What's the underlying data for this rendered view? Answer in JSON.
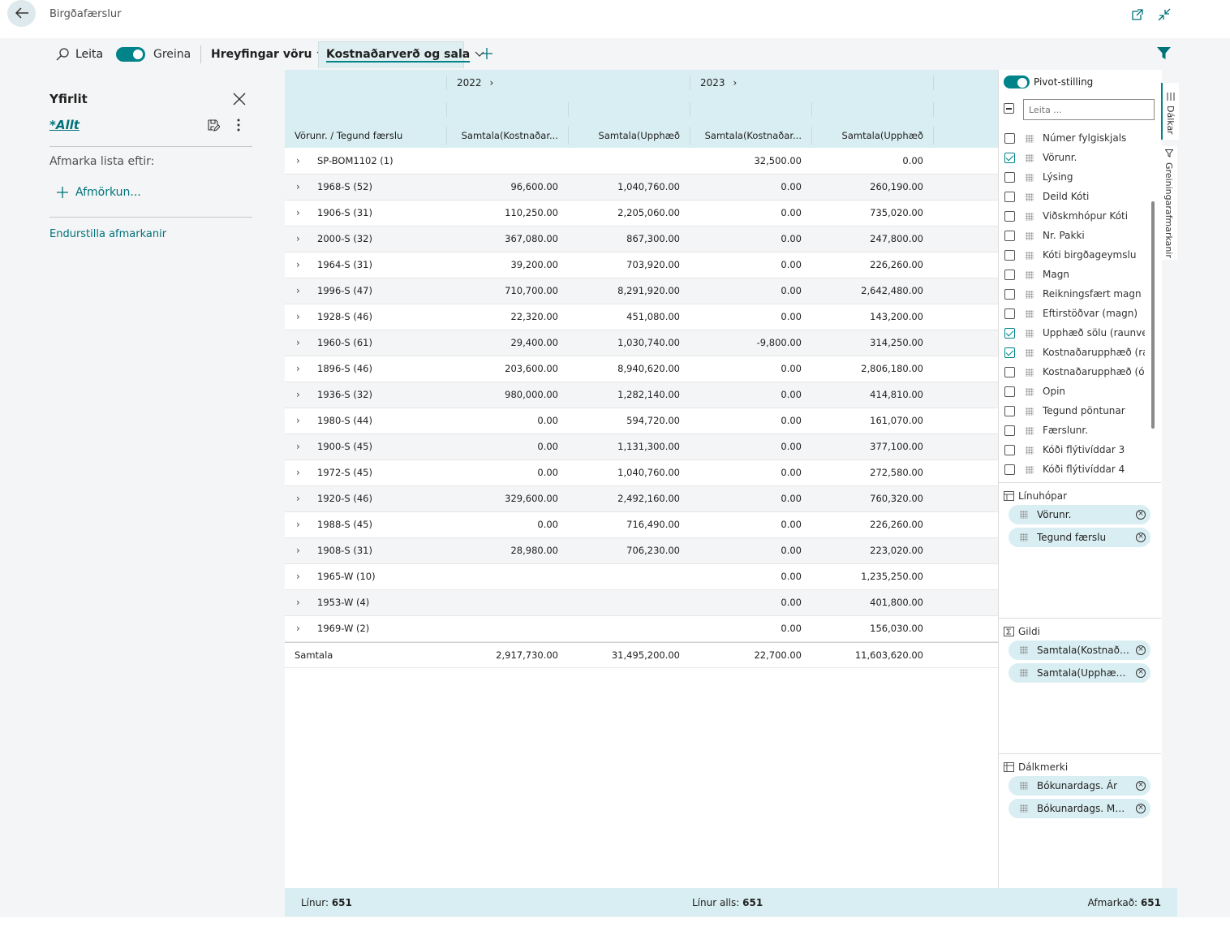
{
  "header": {
    "title": "Birgðafærslur"
  },
  "toolbar": {
    "search_label": "Leita",
    "analyze_label": "Greina",
    "tab1_label": "Hreyfingar vöru",
    "tab2_label": "Kostnaðarverð og sala"
  },
  "left_pane": {
    "title": "Yfirlit",
    "view_name": "*Allt",
    "filter_heading": "Afmarka lista eftir:",
    "add_filter_label": "Afmörkun...",
    "reset_label": "Endurstilla afmarkanir"
  },
  "grid": {
    "year_headers": [
      "2022",
      "2023"
    ],
    "col_headers": [
      "Vörunr. / Tegund færslu",
      "Samtala(Kostnaðar...",
      "Samtala(Upphæð",
      "Samtala(Kostnaðar...",
      "Samtala(Upphæð"
    ],
    "rows": [
      {
        "label": "SP-BOM1102 (1)",
        "v": [
          "",
          "",
          "32,500.00",
          "0.00"
        ]
      },
      {
        "label": "1968-S (52)",
        "v": [
          "96,600.00",
          "1,040,760.00",
          "0.00",
          "260,190.00"
        ]
      },
      {
        "label": "1906-S (31)",
        "v": [
          "110,250.00",
          "2,205,060.00",
          "0.00",
          "735,020.00"
        ]
      },
      {
        "label": "2000-S (32)",
        "v": [
          "367,080.00",
          "867,300.00",
          "0.00",
          "247,800.00"
        ]
      },
      {
        "label": "1964-S (31)",
        "v": [
          "39,200.00",
          "703,920.00",
          "0.00",
          "226,260.00"
        ]
      },
      {
        "label": "1996-S (47)",
        "v": [
          "710,700.00",
          "8,291,920.00",
          "0.00",
          "2,642,480.00"
        ]
      },
      {
        "label": "1928-S (46)",
        "v": [
          "22,320.00",
          "451,080.00",
          "0.00",
          "143,200.00"
        ]
      },
      {
        "label": "1960-S (61)",
        "v": [
          "29,400.00",
          "1,030,740.00",
          "-9,800.00",
          "314,250.00"
        ]
      },
      {
        "label": "1896-S (46)",
        "v": [
          "203,600.00",
          "8,940,620.00",
          "0.00",
          "2,806,180.00"
        ]
      },
      {
        "label": "1936-S (32)",
        "v": [
          "980,000.00",
          "1,282,140.00",
          "0.00",
          "414,810.00"
        ]
      },
      {
        "label": "1980-S (44)",
        "v": [
          "0.00",
          "594,720.00",
          "0.00",
          "161,070.00"
        ]
      },
      {
        "label": "1900-S (45)",
        "v": [
          "0.00",
          "1,131,300.00",
          "0.00",
          "377,100.00"
        ]
      },
      {
        "label": "1972-S (45)",
        "v": [
          "0.00",
          "1,040,760.00",
          "0.00",
          "272,580.00"
        ]
      },
      {
        "label": "1920-S (46)",
        "v": [
          "329,600.00",
          "2,492,160.00",
          "0.00",
          "760,320.00"
        ]
      },
      {
        "label": "1988-S (45)",
        "v": [
          "0.00",
          "716,490.00",
          "0.00",
          "226,260.00"
        ]
      },
      {
        "label": "1908-S (31)",
        "v": [
          "28,980.00",
          "706,230.00",
          "0.00",
          "223,020.00"
        ]
      },
      {
        "label": "1965-W (10)",
        "v": [
          "",
          "",
          "0.00",
          "1,235,250.00"
        ]
      },
      {
        "label": "1953-W (4)",
        "v": [
          "",
          "",
          "0.00",
          "401,800.00"
        ]
      },
      {
        "label": "1969-W (2)",
        "v": [
          "",
          "",
          "0.00",
          "156,030.00"
        ]
      }
    ],
    "total": {
      "label": "Samtala",
      "v": [
        "2,917,730.00",
        "31,495,200.00",
        "22,700.00",
        "11,603,620.00"
      ]
    }
  },
  "status": {
    "lines_label": "Línur:",
    "lines_value": "651",
    "total_label": "Línur alls:",
    "total_value": "651",
    "filtered_label": "Afmarkað:",
    "filtered_value": "651"
  },
  "pivot": {
    "toggle_label": "Pivot-stilling",
    "search_placeholder": "Leita ...",
    "fields": [
      {
        "label": "Númer fylgiskjals",
        "checked": false
      },
      {
        "label": "Vörunr.",
        "checked": true
      },
      {
        "label": "Lýsing",
        "checked": false
      },
      {
        "label": "Deild Kóti",
        "checked": false
      },
      {
        "label": "Viðskmhópur Kóti",
        "checked": false
      },
      {
        "label": "Nr. Pakki",
        "checked": false
      },
      {
        "label": "Kóti birgðageymslu",
        "checked": false
      },
      {
        "label": "Magn",
        "checked": false
      },
      {
        "label": "Reikningsfært magn",
        "checked": false
      },
      {
        "label": "Eftirstöðvar (magn)",
        "checked": false
      },
      {
        "label": "Upphæð sölu (raunve...",
        "checked": true
      },
      {
        "label": "Kostnaðarupphæð (ra...",
        "checked": true
      },
      {
        "label": "Kostnaðarupphæð (ó...",
        "checked": false
      },
      {
        "label": "Opin",
        "checked": false
      },
      {
        "label": "Tegund pöntunar",
        "checked": false
      },
      {
        "label": "Færslunr.",
        "checked": false
      },
      {
        "label": "Kóði flýtivíddar 3",
        "checked": false
      },
      {
        "label": "Kóði flýtivíddar 4",
        "checked": false
      }
    ],
    "row_groups_title": "Línuhópar",
    "row_groups": [
      "Vörunr.",
      "Tegund færslu"
    ],
    "values_title": "Gildi",
    "values": [
      "Samtala(Kostnaðar...",
      "Samtala(Upphæð s..."
    ],
    "col_labels_title": "Dálkmerki",
    "col_labels": [
      "Bókunardags. Ár",
      "Bókunardags. Mán..."
    ],
    "side_tabs": [
      "Dálkar",
      "Greiningarafmarkanir"
    ]
  },
  "colors": {
    "accent": "#008489",
    "header_bg": "#d9eef2"
  }
}
